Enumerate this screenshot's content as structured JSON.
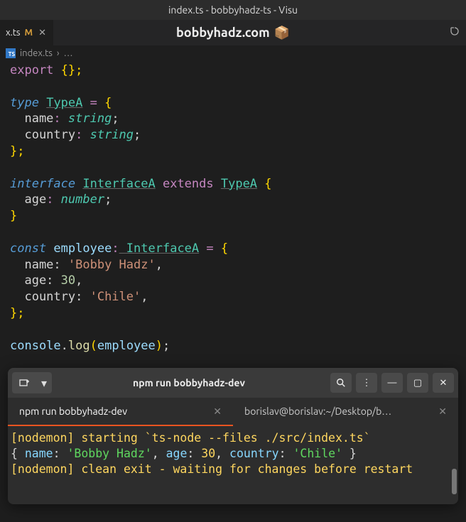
{
  "window": {
    "title": "index.ts - bobbyhadz-ts - Visu"
  },
  "tab": {
    "filename": "x.ts",
    "modified": "M"
  },
  "header": {
    "site": "bobbyhadz.com",
    "icon": "📦"
  },
  "breadcrumb": {
    "file": "index.ts",
    "sep": "›",
    "more": "…"
  },
  "code": {
    "line1_export": "export",
    "line1_rest": " {};",
    "line3_type": "type",
    "line3_name": "TypeA",
    "line3_eq": " = ",
    "line3_brace": "{",
    "line4_prop": "  name",
    "line4_colon": ":",
    "line4_type": " string",
    "line4_semi": ";",
    "line5_prop": "  country",
    "line5_colon": ":",
    "line5_type": " string",
    "line5_semi": ";",
    "line6_close": "};",
    "line8_kw": "interface",
    "line8_name": "InterfaceA",
    "line8_ext": " extends ",
    "line8_base": "TypeA",
    "line8_brace": " {",
    "line9_prop": "  age",
    "line9_colon": ":",
    "line9_type": " number",
    "line9_semi": ";",
    "line10_close": "}",
    "line12_kw": "const",
    "line12_var": " employee",
    "line12_colon": ":",
    "line12_type": " InterfaceA",
    "line12_eq": " = ",
    "line12_brace": "{",
    "line13": "  name: ",
    "line13_val": "'Bobby Hadz'",
    "line13_comma": ",",
    "line14": "  age: ",
    "line14_val": "30",
    "line14_comma": ",",
    "line15": "  country: ",
    "line15_val": "'Chile'",
    "line15_comma": ",",
    "line16_close": "};",
    "line18_obj": "console",
    "line18_dot": ".",
    "line18_fn": "log",
    "line18_open": "(",
    "line18_arg": "employee",
    "line18_close": ")",
    "line18_semi": ";"
  },
  "terminal": {
    "title": "npm run bobbyhadz-dev",
    "tab1": "npm run bobbyhadz-dev",
    "tab2": "borislav@borislav:~/Desktop/b…",
    "out_nodemon1": "[nodemon] starting `ts-node --files ./src/index.ts`",
    "out_brace_open": "{ ",
    "out_k1": "name",
    "out_v1": "'Bobby Hadz'",
    "out_k2": "age",
    "out_v2": "30",
    "out_k3": "country",
    "out_v3": "'Chile'",
    "out_brace_close": " }",
    "out_nodemon2": "[nodemon] clean exit - waiting for changes before restart"
  }
}
